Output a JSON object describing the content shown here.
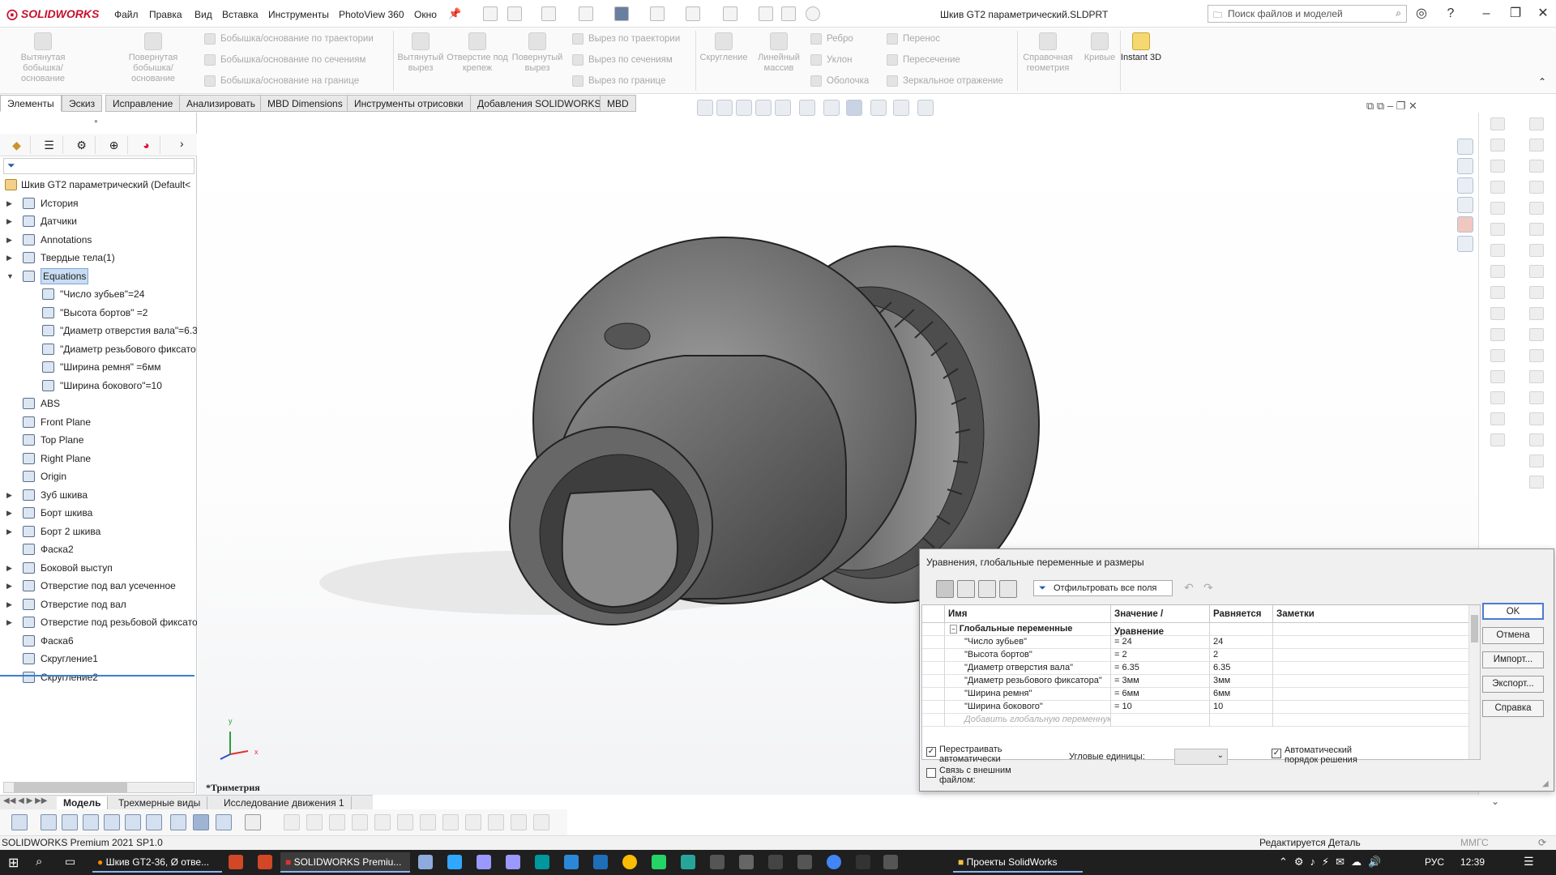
{
  "app": {
    "logo": "SOLIDWORKS",
    "doc_title": "Шкив GT2 параметрический.SLDPRT",
    "search_placeholder": "Поиск файлов и моделей"
  },
  "menu": [
    "Файл",
    "Правка",
    "Вид",
    "Вставка",
    "Инструменты",
    "PhotoView 360",
    "Окно"
  ],
  "ribbon": {
    "big": [
      {
        "label": "Вытянутая бобышка/основание"
      },
      {
        "label": "Повернутая бобышка/основание"
      },
      {
        "label": "Вытянутый вырез"
      },
      {
        "label": "Отверстие под крепеж"
      },
      {
        "label": "Повернутый вырез"
      },
      {
        "label": "Скругление"
      },
      {
        "label": "Линейный массив"
      },
      {
        "label": "Справочная геометрия"
      },
      {
        "label": "Кривые"
      },
      {
        "label": "Instant 3D"
      }
    ],
    "small_a": [
      "Бобышка/основание по траектории",
      "Бобышка/основание по сечениям",
      "Бобышка/основание на границе"
    ],
    "small_b": [
      "Вырез по траектории",
      "Вырез по сечениям",
      "Вырез по границе"
    ],
    "small_c": [
      "Ребро",
      "Уклон",
      "Оболочка"
    ],
    "small_d": [
      "Перенос",
      "Пересечение",
      "Зеркальное отражение"
    ]
  },
  "tabs": [
    "Элементы",
    "Эскиз",
    "Исправление",
    "Анализировать",
    "MBD Dimensions",
    "Инструменты отрисовки",
    "Добавления SOLIDWORKS",
    "MBD"
  ],
  "tree": {
    "root": "Шкив GT2 параметрический  (Default<",
    "items": [
      {
        "label": "История",
        "level": 1,
        "arrow": "▶"
      },
      {
        "label": "Датчики",
        "level": 1,
        "arrow": "▶"
      },
      {
        "label": "Annotations",
        "level": 1,
        "arrow": "▶"
      },
      {
        "label": "Твердые тела(1)",
        "level": 1,
        "arrow": "▶"
      },
      {
        "label": "Equations",
        "level": 1,
        "arrow": "▼",
        "selected": true
      },
      {
        "label": "\"Число зубьев\"=24",
        "level": 2,
        "arrow": ""
      },
      {
        "label": "\"Высота бортов\" =2",
        "level": 2,
        "arrow": ""
      },
      {
        "label": "\"Диаметр отверстия вала\"=6.3",
        "level": 2,
        "arrow": ""
      },
      {
        "label": "\"Диаметр резьбового фиксато",
        "level": 2,
        "arrow": ""
      },
      {
        "label": "\"Ширина ремня\" =6мм",
        "level": 2,
        "arrow": ""
      },
      {
        "label": "\"Ширина бокового\"=10",
        "level": 2,
        "arrow": ""
      },
      {
        "label": "ABS",
        "level": 1,
        "arrow": ""
      },
      {
        "label": "Front Plane",
        "level": 1,
        "arrow": ""
      },
      {
        "label": "Top Plane",
        "level": 1,
        "arrow": ""
      },
      {
        "label": "Right Plane",
        "level": 1,
        "arrow": ""
      },
      {
        "label": "Origin",
        "level": 1,
        "arrow": ""
      },
      {
        "label": "Зуб шкива",
        "level": 1,
        "arrow": "▶"
      },
      {
        "label": "Борт шкива",
        "level": 1,
        "arrow": "▶"
      },
      {
        "label": "Борт 2 шкива",
        "level": 1,
        "arrow": "▶"
      },
      {
        "label": "Фаска2",
        "level": 1,
        "arrow": ""
      },
      {
        "label": "Боковой выступ",
        "level": 1,
        "arrow": "▶"
      },
      {
        "label": "Отверстие под вал усеченное",
        "level": 1,
        "arrow": "▶"
      },
      {
        "label": "Отверстие под вал",
        "level": 1,
        "arrow": "▶"
      },
      {
        "label": "Отверстие под резьбовой фиксато",
        "level": 1,
        "arrow": "▶"
      },
      {
        "label": "Фаска6",
        "level": 1,
        "arrow": ""
      },
      {
        "label": "Скругление1",
        "level": 1,
        "arrow": ""
      },
      {
        "label": "Скругление2",
        "level": 1,
        "arrow": ""
      }
    ]
  },
  "viewport": {
    "view_label": "*Триметрия",
    "axis_x": "x",
    "axis_y": "y"
  },
  "dialog": {
    "title": "Уравнения, глобальные переменные и размеры",
    "filter_label": "Отфильтровать все поля",
    "columns": [
      "Имя",
      "Значение / Уравнение",
      "Равняется",
      "Заметки"
    ],
    "group": "Глобальные переменные",
    "rows": [
      {
        "name": "\"Число зубьев\"",
        "value": "= 24",
        "result": "24"
      },
      {
        "name": "\"Высота бортов\"",
        "value": "= 2",
        "result": "2"
      },
      {
        "name": "\"Диаметр отверстия вала\"",
        "value": "= 6.35",
        "result": "6.35"
      },
      {
        "name": "\"Диаметр резьбового фиксатора\"",
        "value": "= 3мм",
        "result": "3мм"
      },
      {
        "name": "\"Ширина ремня\"",
        "value": "= 6мм",
        "result": "6мм"
      },
      {
        "name": "\"Ширина бокового\"",
        "value": "= 10",
        "result": "10"
      }
    ],
    "add_placeholder": "Добавить глобальную переменную",
    "buttons": {
      "ok": "OK",
      "cancel": "Отмена",
      "import": "Импорт...",
      "export": "Экспорт...",
      "help": "Справка"
    },
    "rebuild_label": "Перестраивать автоматически",
    "link_label": "Связь с внешним файлом:",
    "angular_label": "Угловые единицы:",
    "auto_order_label": "Автоматический порядок решения"
  },
  "bottom_tabs": [
    "Модель",
    "Трехмерные виды",
    "Исследование движения 1"
  ],
  "status": {
    "left": "SOLIDWORKS Premium 2021 SP1.0",
    "center": "Редактируется Деталь",
    "units": "ММГС"
  },
  "taskbar": {
    "apps": [
      "Шкив GT2-36, Ø отве...",
      "SOLIDWORKS Premiu...",
      "Проекты SolidWorks"
    ],
    "lang": "РУС",
    "time": "12:39"
  }
}
